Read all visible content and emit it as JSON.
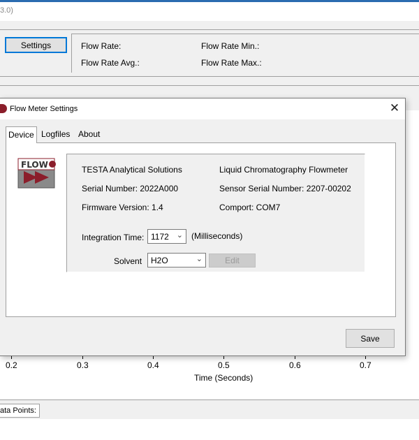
{
  "main_window": {
    "title_fragment": "3.0)",
    "settings_button": "Settings",
    "readouts": {
      "flow_rate": "Flow Rate:",
      "flow_rate_min": "Flow Rate Min.:",
      "flow_rate_avg": "Flow Rate Avg.:",
      "flow_rate_max": "Flow Rate Max.:"
    },
    "chart": {
      "x_ticks": [
        "0.2",
        "0.3",
        "0.4",
        "0.5",
        "0.6",
        "0.7"
      ],
      "x_axis_title": "Time (Seconds)"
    },
    "status_tab": "ata Points:"
  },
  "dialog": {
    "title": "Flow Meter Settings",
    "close_glyph": "✕",
    "tabs": [
      {
        "label": "Device",
        "active": true
      },
      {
        "label": "Logfiles",
        "active": false
      },
      {
        "label": "About",
        "active": false
      }
    ],
    "logo_text": "FLOW",
    "device": {
      "company": "TESTA Analytical Solutions",
      "product": "Liquid Chromatography Flowmeter",
      "serial_number": "Serial Number: 2022A000",
      "sensor_serial_number": "Sensor Serial Number: 2207-00202",
      "firmware_version": "Firmware Version: 1.4",
      "comport": "Comport: COM7",
      "integration_time_label": "Integration Time:",
      "integration_time_value": "1172",
      "integration_time_unit": "(Milliseconds)",
      "solvent_label": "Solvent",
      "solvent_value": "H2O",
      "edit_button": "Edit"
    },
    "save_button": "Save"
  },
  "icons": {
    "dropdown_arrow": "chevron-down-icon",
    "app_icon": "flow-app-icon",
    "close": "close-icon"
  },
  "colors": {
    "accent_blue": "#0078d7",
    "logo_red": "#8b1e2b"
  }
}
